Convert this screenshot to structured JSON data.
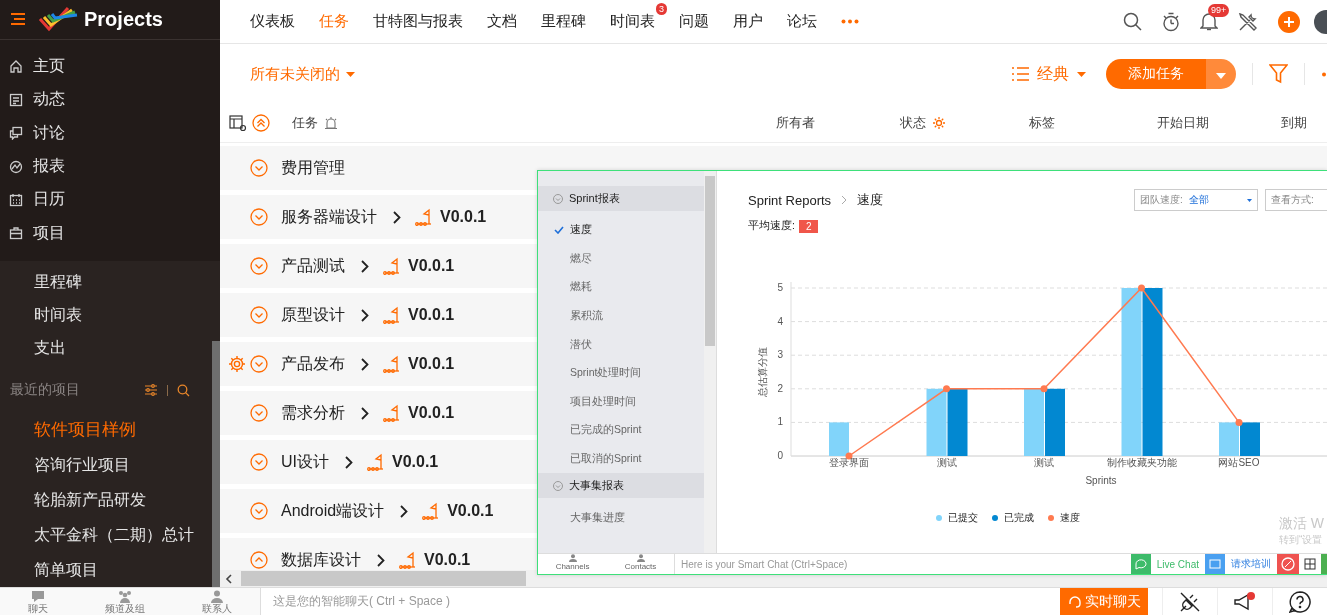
{
  "app": {
    "title": "Projects"
  },
  "nav": {
    "items": [
      {
        "label": "仪表板",
        "selected": false
      },
      {
        "label": "任务",
        "selected": true
      },
      {
        "label": "甘特图与报表",
        "selected": false
      },
      {
        "label": "文档",
        "selected": false
      },
      {
        "label": "里程碑",
        "selected": false
      },
      {
        "label": "时间表",
        "selected": false,
        "badge": "3"
      },
      {
        "label": "问题",
        "selected": false
      },
      {
        "label": "用户",
        "selected": false
      },
      {
        "label": "论坛",
        "selected": false
      }
    ],
    "notification_badge": "99+"
  },
  "sidebar": {
    "main_items": [
      {
        "label": "主页"
      },
      {
        "label": "动态"
      },
      {
        "label": "讨论"
      },
      {
        "label": "报表"
      },
      {
        "label": "日历"
      },
      {
        "label": "项目"
      }
    ],
    "sub_items": [
      "里程碑",
      "时间表",
      "支出"
    ],
    "recent": {
      "title": "最近的项目",
      "items": [
        {
          "label": "软件项目样例",
          "selected": true
        },
        {
          "label": "咨询行业项目",
          "selected": false
        },
        {
          "label": "轮胎新产品研发",
          "selected": false
        },
        {
          "label": "太平金科（二期）总计",
          "selected": false
        },
        {
          "label": "简单项目",
          "selected": false
        }
      ]
    }
  },
  "toolbar": {
    "filter": "所有未关闭的",
    "view": "经典",
    "add_button": "添加任务"
  },
  "columns": [
    "任务",
    "所有者",
    "状态",
    "标签",
    "开始日期",
    "到期"
  ],
  "tasks": [
    {
      "name": "费用管理",
      "expanded": false,
      "hovered": false
    },
    {
      "name": "服务器端设计",
      "milestone": "V0.0.1",
      "expanded": false,
      "hovered": false
    },
    {
      "name": "产品测试",
      "milestone": "V0.0.1",
      "expanded": false,
      "hovered": false
    },
    {
      "name": "原型设计",
      "milestone": "V0.0.1",
      "expanded": false,
      "hovered": false
    },
    {
      "name": "产品发布",
      "milestone": "V0.0.1",
      "expanded": false,
      "hovered": true
    },
    {
      "name": "需求分析",
      "milestone": "V0.0.1",
      "expanded": false,
      "hovered": false
    },
    {
      "name": "UI设计",
      "milestone": "V0.0.1",
      "expanded": false,
      "hovered": false
    },
    {
      "name": "Android端设计",
      "milestone": "V0.0.1",
      "expanded": false,
      "hovered": false
    },
    {
      "name": "数据库设计",
      "milestone": "V0.0.1",
      "expanded": true,
      "hovered": false
    }
  ],
  "overlay": {
    "groups": [
      {
        "title": "Sprint报表",
        "items": [
          {
            "label": "速度",
            "selected": true
          },
          {
            "label": "燃尽",
            "selected": false
          },
          {
            "label": "燃耗",
            "selected": false
          },
          {
            "label": "累积流",
            "selected": false
          },
          {
            "label": "潜伏",
            "selected": false
          },
          {
            "label": "Sprint处理时间",
            "selected": false
          },
          {
            "label": "项目处理时间",
            "selected": false
          },
          {
            "label": "已完成的Sprint",
            "selected": false
          },
          {
            "label": "已取消的Sprint",
            "selected": false
          }
        ]
      },
      {
        "title": "大事集报表",
        "items": [
          {
            "label": "大事集进度",
            "selected": false
          }
        ]
      }
    ],
    "breadcrumb": [
      "Sprint Reports",
      "速度"
    ],
    "average": {
      "label": "平均速度:",
      "value": "2"
    },
    "filters": [
      {
        "label": "团队速度:",
        "value": "全部"
      },
      {
        "label": "查看方式:"
      }
    ],
    "chart_data": {
      "type": "bar",
      "xlabel": "Sprints",
      "ylabel": "总估算分值",
      "categories": [
        "登录界面",
        "测试",
        "测试",
        "制作收藏夹功能",
        "网站SEO"
      ],
      "ylim": [
        0,
        5
      ],
      "yticks": [
        0,
        1,
        2,
        3,
        4,
        5
      ],
      "grid": true,
      "series": [
        {
          "name": "已提交",
          "color": "#81d4fa",
          "type": "bar",
          "values": [
            1,
            2,
            2,
            5,
            1
          ]
        },
        {
          "name": "已完成",
          "color": "#0288d1",
          "type": "bar",
          "values": [
            0,
            2,
            2,
            5,
            1
          ]
        },
        {
          "name": "速度",
          "color": "#ff7a50",
          "type": "line",
          "marker": true,
          "values": [
            0,
            2,
            2,
            5,
            1
          ]
        }
      ]
    },
    "activation_notice": [
      "激活 W",
      "转到“设置"
    ],
    "chat": {
      "tabs": [
        "Channels",
        "Contacts"
      ],
      "placeholder": "Here is your Smart Chat (Ctrl+Space)",
      "buttons": [
        "Live Chat",
        "请求培训"
      ]
    }
  },
  "chat_bar": {
    "tabs": [
      "聊天",
      "频道及组",
      "联系人"
    ],
    "placeholder": "这是您的智能聊天( Ctrl + Space )",
    "live_chat": "实时聊天"
  }
}
